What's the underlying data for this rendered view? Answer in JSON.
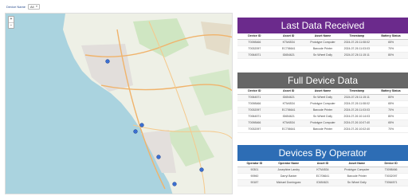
{
  "filter": {
    "label": "Device Name",
    "value": "All"
  },
  "map": {
    "zoom_in": "+",
    "zoom_out": "−",
    "markers": [
      "location-marker",
      "location-marker",
      "location-marker",
      "location-marker",
      "location-marker",
      "location-marker"
    ]
  },
  "last_data": {
    "title": "Last Data Received",
    "columns": [
      "Device ID",
      "Asset ID",
      "Asset Name",
      "Timestamp",
      "Battery Status"
    ],
    "rows": [
      [
        "T0098466",
        "KTM4534",
        "Prototype Computer",
        "2024-07-26 11:08:02",
        "65%"
      ],
      [
        "T0032097",
        "EC706641",
        "Barcode Printer",
        "2024-07-26 11:03:03",
        "70%"
      ],
      [
        "T0064571",
        "ID654621",
        "Sn Wheel Dolly",
        "2024-07-26 11:15:11",
        "80%"
      ]
    ]
  },
  "full_data": {
    "title": "Full Device Data",
    "columns": [
      "Device ID",
      "Asset ID",
      "Asset Name",
      "Timestamp",
      "Battery Status"
    ],
    "rows": [
      [
        "T0064571",
        "ID654621",
        "Sn Wheel Dolly",
        "2024-07-26 11:15:11",
        "80%"
      ],
      [
        "T0098466",
        "KTM4534",
        "Prototype Computer",
        "2024-07-26 11:08:02",
        "65%"
      ],
      [
        "T0032097",
        "EC706641",
        "Barcode Printer",
        "2024-07-26 11:03:03",
        "70%"
      ],
      [
        "T0064571",
        "ID654621",
        "Sn Wheel Dolly",
        "2024-07-26 10:14:03",
        "80%"
      ],
      [
        "T0098466",
        "KTM4534",
        "Prototype Computer",
        "2024-07-26 10:07:40",
        "65%"
      ],
      [
        "T0032097",
        "EC706641",
        "Barcode Printer",
        "2024-07-26 10:02:40",
        "70%"
      ]
    ]
  },
  "operators": {
    "title": "Devices By Operator",
    "columns": [
      "Operator ID",
      "Operator Name",
      "Asset ID",
      "Asset Name",
      "Device ID"
    ],
    "rows": [
      [
        "90301",
        "Josephine Landry",
        "KTM4534",
        "Prototype Computer",
        "T0098466"
      ],
      [
        "90960",
        "Darryl Barker",
        "EC706641",
        "Barcode Printer",
        "T0032097"
      ],
      [
        "90187",
        "Michael Dominguez",
        "ID654621",
        "Sn Wheel Dolly",
        "T0064571"
      ]
    ]
  }
}
